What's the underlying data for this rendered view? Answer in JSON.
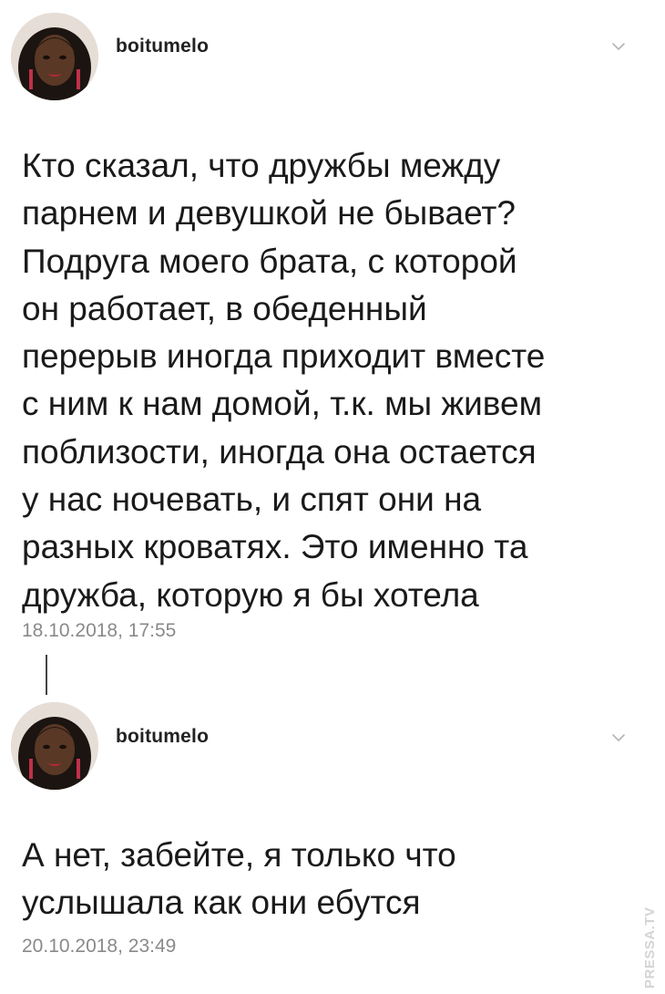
{
  "posts": [
    {
      "username": "boitumelo",
      "text": "Кто сказал, что дружбы между\nпарнем и девушкой не бывает?\nПодруга моего брата, с которой\nон работает, в обеденный\nперерыв иногда приходит вместе\nс ним к нам домой, т.к. мы живем\nпоблизости, иногда она остается\nу нас ночевать, и спят они на\nразных кроватях. Это именно та\nдружба, которую я бы хотела",
      "timestamp": "18.10.2018, 17:55",
      "avatar_icon": "profile-photo",
      "menu_icon": "chevron-down-icon"
    },
    {
      "username": "boitumelo",
      "text": "А нет, забейте, я только что\nуслышала как они ебутся",
      "timestamp": "20.10.2018, 23:49",
      "avatar_icon": "profile-photo",
      "menu_icon": "chevron-down-icon"
    }
  ],
  "watermark": "PRESSA.TV",
  "colors": {
    "text": "#1a1a1a",
    "timestamp": "#8a8a8a",
    "chevron": "#b5b5b5",
    "thread_line": "#444444"
  }
}
